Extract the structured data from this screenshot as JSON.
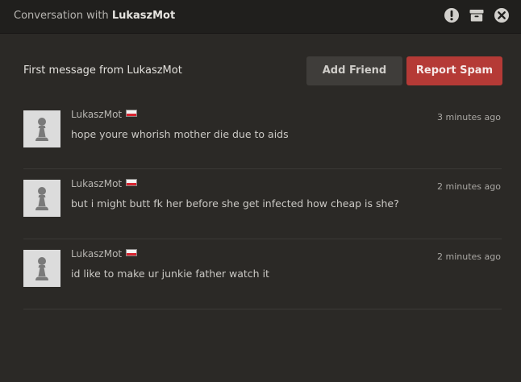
{
  "window": {
    "title_prefix": "Conversation with",
    "title_user": "LukaszMot",
    "icons": [
      "alert-icon",
      "archive-icon",
      "close-icon"
    ]
  },
  "header": {
    "first_message": "First message from LukaszMot",
    "add_friend_label": "Add Friend",
    "report_spam_label": "Report Spam"
  },
  "colors": {
    "background": "#2b2926",
    "titlebar": "#201f1d",
    "report_spam": "#b53a36",
    "add_friend": "#3f3d3a",
    "flag": "Poland"
  },
  "messages": [
    {
      "username": "LukaszMot",
      "flag": "poland-flag-icon",
      "time": "3 minutes ago",
      "text": "hope youre whorish mother die due to aids",
      "avatar": "chess-pawn-avatar-icon"
    },
    {
      "username": "LukaszMot",
      "flag": "poland-flag-icon",
      "time": "2 minutes ago",
      "text": "but i might butt fk her before she get infected how cheap is she?",
      "avatar": "chess-pawn-avatar-icon"
    },
    {
      "username": "LukaszMot",
      "flag": "poland-flag-icon",
      "time": "2 minutes ago",
      "text": "id like to make ur junkie father watch it",
      "avatar": "chess-pawn-avatar-icon"
    }
  ]
}
